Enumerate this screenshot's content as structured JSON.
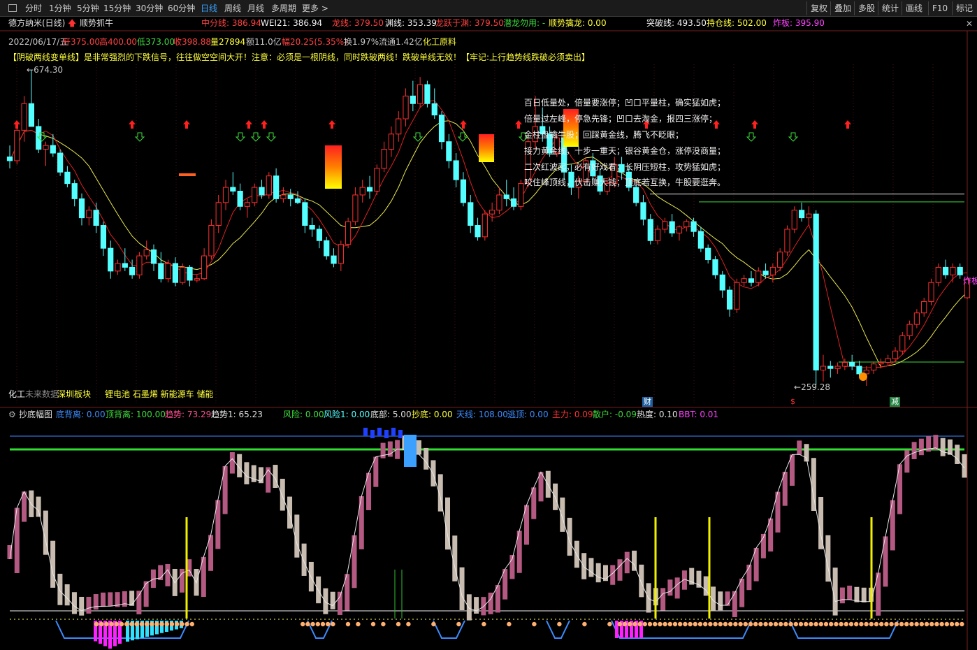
{
  "toolbar": {
    "timeframes": [
      "分时",
      "1分钟",
      "5分钟",
      "15分钟",
      "30分钟",
      "60分钟",
      "日线",
      "周线",
      "月线",
      "多周期",
      "更多 >"
    ],
    "active_index": 6,
    "right_buttons": [
      "复权",
      "叠加",
      "多股",
      "统计",
      "画线",
      "F10",
      "标记"
    ]
  },
  "header": {
    "stock": "德方纳米(日线)",
    "indicator": "顺势抓牛",
    "mid_line": "中分线: 386.94",
    "wei": "WEI21: 386.94",
    "dragon": "龙线: 379.50",
    "abyss": "渊线: 353.39",
    "leap": "龙跃于渊: 379.50",
    "hidden": "潜龙勿用: -",
    "follow": "顺势擒龙: 0.00",
    "breakout": "突破线: 493.50",
    "position": "持仓线: 502.00",
    "explode": "炸板: 395.90"
  },
  "quote": {
    "date": "2022/06/17/五",
    "open": "开375.00",
    "high": "高400.00",
    "low": "低373.00",
    "close": "收398.88",
    "volume": "量27894",
    "amount": "额11.0亿",
    "amplitude": "幅20.25(5.35%)",
    "turnover": "换1.97%",
    "float": "流通1.42亿",
    "industry": "化工原料"
  },
  "warning": "【阴破两线变单线】是非常强烈的下跌信号，往往做空空间大开！注意：必须是一根阴线，同时跌破两线！跌破单线无效！【牢记:上行趋势线跌破必须卖出】",
  "price_labels": {
    "high": "674.30",
    "low": "259.28",
    "explode_tag": "炸板"
  },
  "poem": [
    "百日低量处，倍量要涨停；凹口平量柱，确实猛如虎；",
    "倍量过左峰，停急先锋；凹口去淘金，报四三涨停；",
    "金柱盘擒牛股；回踩黄金线，腾飞不眨眼；",
    "接力黄金线，十步一重天；银谷黄金仓，涨停没商量；",
    "二次红波起，必有好戏看；长阴压短柱，攻势猛如虎；",
    "咬住峰顶线，伏击赚大钱；顶底若互换，牛股要逛奔。"
  ],
  "bottom_tags": {
    "industry": "化工",
    "no_data": "未来数据",
    "sectors": "深圳板块",
    "concepts": "锂电池 石墨烯 新能源车 储能",
    "cai": "财",
    "s": "$",
    "jian": "减"
  },
  "sub_header": {
    "name": "抄底幅图",
    "bottom_dev": "底背离: 0.00",
    "top_dev": "顶背离: 100.00",
    "trend": "趋势: 73.29",
    "trend1": "趋势1: 65.23",
    "risk": "风险: 0.00",
    "risk1": "风险1: 0.00",
    "bottom": "底部: 5.00",
    "chaodi": "抄底: 0.00",
    "tianxian": "天线: 108.00",
    "escape": "逃顶: 0.00",
    "main_force": "主力: 0.09",
    "retail": "散户: -0.09",
    "heat": "热度: 0.10",
    "bbt": "BBT: 0.01"
  },
  "colors": {
    "up": "#ff3030",
    "down": "#54ffff",
    "ma_red": "#e02020",
    "ma_yellow": "#e8e850",
    "ma_green": "#3cdc3c",
    "pink": "#b45a82",
    "beige": "#c8bcb0",
    "yellow": "#f0f000",
    "blue": "#3c8cff"
  },
  "chart_data": {
    "type": "candlestick",
    "y_range": [
      259.28,
      674.3
    ],
    "y_levels": {
      "breakout": 493.5,
      "position": 502.0
    },
    "candles": [
      [
        560,
        575,
        545,
        555
      ],
      [
        555,
        600,
        550,
        595
      ],
      [
        595,
        640,
        580,
        630
      ],
      [
        630,
        674.3,
        620,
        600
      ],
      [
        600,
        610,
        565,
        570
      ],
      [
        570,
        580,
        548,
        575
      ],
      [
        575,
        590,
        560,
        565
      ],
      [
        565,
        570,
        535,
        540
      ],
      [
        540,
        548,
        520,
        525
      ],
      [
        525,
        530,
        495,
        505
      ],
      [
        505,
        512,
        470,
        480
      ],
      [
        480,
        495,
        470,
        490
      ],
      [
        490,
        500,
        460,
        470
      ],
      [
        470,
        475,
        430,
        440
      ],
      [
        440,
        450,
        400,
        410
      ],
      [
        410,
        425,
        405,
        420
      ],
      [
        420,
        440,
        410,
        415
      ],
      [
        415,
        425,
        400,
        405
      ],
      [
        405,
        435,
        400,
        430
      ],
      [
        430,
        450,
        425,
        438
      ],
      [
        438,
        445,
        410,
        420
      ],
      [
        420,
        435,
        395,
        400
      ],
      [
        400,
        425,
        395,
        420
      ],
      [
        420,
        428,
        390,
        395
      ],
      [
        395,
        420,
        392,
        415
      ],
      [
        415,
        418,
        390,
        398
      ],
      [
        398,
        405,
        395,
        400
      ],
      [
        400,
        440,
        398,
        430
      ],
      [
        430,
        478,
        425,
        470
      ],
      [
        470,
        510,
        460,
        500
      ],
      [
        500,
        530,
        490,
        520
      ],
      [
        520,
        540,
        510,
        515
      ],
      [
        515,
        525,
        490,
        495
      ],
      [
        495,
        505,
        480,
        500
      ],
      [
        500,
        525,
        495,
        520
      ],
      [
        520,
        530,
        505,
        510
      ],
      [
        510,
        540,
        505,
        535
      ],
      [
        535,
        545,
        500,
        505
      ],
      [
        505,
        520,
        500,
        510
      ],
      [
        510,
        518,
        495,
        505
      ],
      [
        505,
        515,
        498,
        500
      ],
      [
        500,
        505,
        460,
        470
      ],
      [
        470,
        480,
        455,
        465
      ],
      [
        465,
        470,
        440,
        450
      ],
      [
        450,
        455,
        425,
        430
      ],
      [
        430,
        440,
        415,
        420
      ],
      [
        420,
        450,
        410,
        445
      ],
      [
        445,
        480,
        440,
        475
      ],
      [
        475,
        520,
        470,
        510
      ],
      [
        510,
        530,
        500,
        520
      ],
      [
        520,
        535,
        505,
        515
      ],
      [
        515,
        550,
        510,
        545
      ],
      [
        545,
        580,
        540,
        570
      ],
      [
        570,
        600,
        560,
        590
      ],
      [
        590,
        620,
        580,
        610
      ],
      [
        610,
        650,
        600,
        640
      ],
      [
        640,
        660,
        620,
        630
      ],
      [
        630,
        665,
        625,
        655
      ],
      [
        655,
        660,
        625,
        630
      ],
      [
        630,
        650,
        610,
        615
      ],
      [
        615,
        620,
        570,
        580
      ],
      [
        580,
        590,
        545,
        555
      ],
      [
        555,
        565,
        520,
        530
      ],
      [
        530,
        540,
        495,
        500
      ],
      [
        500,
        510,
        460,
        470
      ],
      [
        470,
        480,
        450,
        455
      ],
      [
        455,
        490,
        450,
        485
      ],
      [
        485,
        500,
        475,
        490
      ],
      [
        490,
        520,
        485,
        510
      ],
      [
        510,
        530,
        495,
        505
      ],
      [
        505,
        520,
        490,
        495
      ],
      [
        495,
        530,
        490,
        525
      ],
      [
        525,
        590,
        520,
        580
      ],
      [
        580,
        640,
        570,
        600
      ],
      [
        600,
        625,
        580,
        590
      ],
      [
        590,
        600,
        560,
        565
      ],
      [
        565,
        590,
        560,
        585
      ],
      [
        585,
        595,
        530,
        540
      ],
      [
        540,
        550,
        510,
        520
      ],
      [
        520,
        535,
        505,
        528
      ],
      [
        528,
        560,
        525,
        555
      ],
      [
        555,
        565,
        530,
        535
      ],
      [
        535,
        545,
        510,
        515
      ],
      [
        515,
        530,
        510,
        525
      ],
      [
        525,
        560,
        520,
        550
      ],
      [
        550,
        560,
        530,
        540
      ],
      [
        540,
        548,
        515,
        520
      ],
      [
        520,
        530,
        495,
        500
      ],
      [
        500,
        510,
        470,
        478
      ],
      [
        478,
        485,
        445,
        450
      ],
      [
        450,
        470,
        445,
        465
      ],
      [
        465,
        480,
        460,
        475
      ],
      [
        475,
        485,
        455,
        460
      ],
      [
        460,
        470,
        450,
        468
      ],
      [
        468,
        478,
        462,
        475
      ],
      [
        475,
        480,
        455,
        462
      ],
      [
        462,
        468,
        435,
        440
      ],
      [
        440,
        445,
        420,
        425
      ],
      [
        425,
        430,
        400,
        405
      ],
      [
        405,
        410,
        375,
        385
      ],
      [
        385,
        390,
        350,
        360
      ],
      [
        360,
        400,
        355,
        395
      ],
      [
        395,
        405,
        390,
        400
      ],
      [
        400,
        410,
        390,
        395
      ],
      [
        395,
        415,
        390,
        410
      ],
      [
        410,
        420,
        400,
        405
      ],
      [
        405,
        420,
        395,
        415
      ],
      [
        415,
        440,
        410,
        435
      ],
      [
        435,
        470,
        430,
        465
      ],
      [
        465,
        495,
        460,
        490
      ],
      [
        490,
        500,
        475,
        480
      ],
      [
        480,
        495,
        470,
        485
      ],
      [
        485,
        490,
        260,
        280
      ],
      [
        280,
        300,
        265,
        285
      ],
      [
        285,
        292,
        270,
        282
      ],
      [
        282,
        290,
        275,
        285
      ],
      [
        285,
        295,
        280,
        290
      ],
      [
        290,
        300,
        280,
        285
      ],
      [
        285,
        292,
        270,
        275
      ],
      [
        275,
        285,
        259.28,
        280
      ],
      [
        280,
        290,
        275,
        288
      ],
      [
        288,
        295,
        282,
        290
      ],
      [
        290,
        300,
        285,
        295
      ],
      [
        295,
        310,
        290,
        305
      ],
      [
        305,
        330,
        300,
        325
      ],
      [
        325,
        345,
        320,
        340
      ],
      [
        340,
        360,
        335,
        355
      ],
      [
        355,
        375,
        350,
        370
      ],
      [
        370,
        400,
        365,
        395
      ],
      [
        395,
        420,
        390,
        415
      ],
      [
        415,
        425,
        400,
        405
      ],
      [
        405,
        420,
        395,
        415
      ],
      [
        415,
        420,
        400,
        405
      ],
      [
        375,
        400,
        373,
        398.88
      ]
    ]
  }
}
